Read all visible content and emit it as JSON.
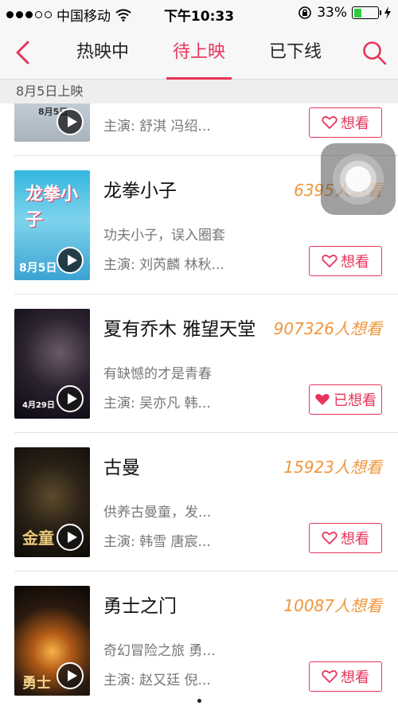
{
  "status": {
    "carrier": "中国移动",
    "time": "下午10:33",
    "battery": "33%"
  },
  "nav": {
    "tabs": [
      "热映中",
      "待上映",
      "已下线"
    ],
    "active_tab": 1
  },
  "section": {
    "header": "8月5日上映"
  },
  "movies": [
    {
      "title": "",
      "want_count": "",
      "desc": "",
      "cast": "主演: 舒淇 冯绍...",
      "button": "想看",
      "wanted": false,
      "poster_text": "8月5日"
    },
    {
      "title": "龙拳小子",
      "want_count": "6395人想看",
      "desc": "功夫小子，误入圈套",
      "cast": "主演: 刘芮麟 林秋...",
      "button": "想看",
      "wanted": false,
      "poster_text": "龙拳小子",
      "poster_date": "8月5日"
    },
    {
      "title": "夏有乔木 雅望天堂",
      "want_count": "907326人想看",
      "desc": "有缺憾的才是青春",
      "cast": "主演: 吴亦凡 韩...",
      "button": "已想看",
      "wanted": true,
      "poster_text": "4月29日"
    },
    {
      "title": "古曼",
      "want_count": "15923人想看",
      "desc": "供养古曼童，发...",
      "cast": "主演: 韩雪 唐宸...",
      "button": "想看",
      "wanted": false,
      "poster_text": "金童"
    },
    {
      "title": "勇士之门",
      "want_count": "10087人想看",
      "desc": "奇幻冒险之旅 勇...",
      "cast": "主演: 赵又廷 倪...",
      "button": "想看",
      "wanted": false,
      "poster_text": "勇士"
    }
  ],
  "colors": {
    "accent": "#e8345a",
    "want_count": "#f0963c"
  }
}
